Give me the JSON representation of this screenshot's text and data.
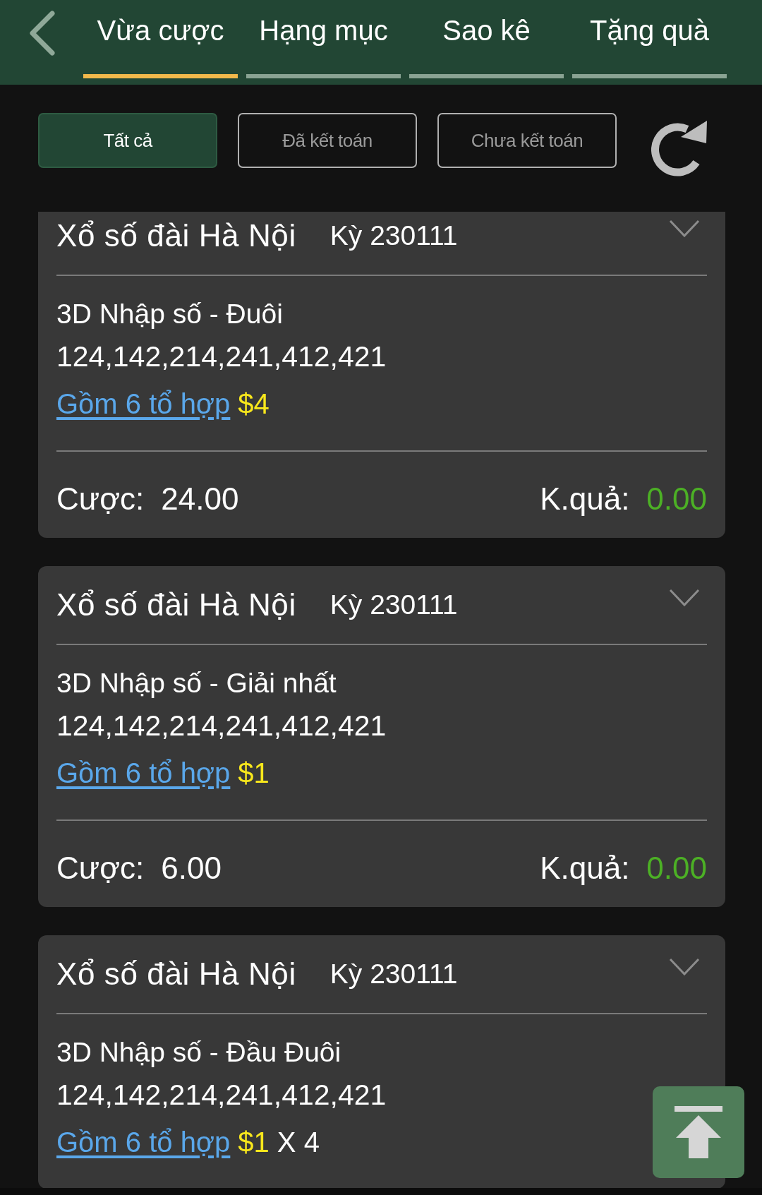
{
  "tabs": [
    {
      "label": "Vừa cược",
      "selected": true
    },
    {
      "label": "Hạng mục",
      "selected": false
    },
    {
      "label": "Sao kê",
      "selected": false
    },
    {
      "label": "Tặng quà",
      "selected": false
    }
  ],
  "filters": [
    {
      "label": "Tất cả",
      "selected": true
    },
    {
      "label": "Đã kết toán",
      "selected": false
    },
    {
      "label": "Chưa kết toán",
      "selected": false
    }
  ],
  "bets": [
    {
      "lottery": "Xổ số đài Hà Nội",
      "period": "Kỳ 230111",
      "bet_type": "3D Nhập số - Đuôi",
      "numbers": "124,142,214,241,412,421",
      "combo_link": "Gồm 6 tổ hợp",
      "unit_amount": "$4",
      "footer": {
        "bet_label": "Cược:",
        "bet_value": "24.00",
        "result_label": "K.quả:",
        "result_value": "0.00"
      }
    },
    {
      "lottery": "Xổ số đài Hà Nội",
      "period": "Kỳ 230111",
      "bet_type": "3D Nhập số - Giải nhất",
      "numbers": "124,142,214,241,412,421",
      "combo_link": "Gồm 6 tổ hợp",
      "unit_amount": "$1",
      "footer": {
        "bet_label": "Cược:",
        "bet_value": "6.00",
        "result_label": "K.quả:",
        "result_value": "0.00"
      }
    },
    {
      "lottery": "Xổ số đài Hà Nội",
      "period": "Kỳ 230111",
      "bet_type": "3D Nhập số - Đầu Đuôi",
      "numbers": "124,142,214,241,412,421",
      "combo_link": "Gồm 6 tổ hợp",
      "unit_amount": "$1",
      "multiplier": "X 4"
    }
  ]
}
